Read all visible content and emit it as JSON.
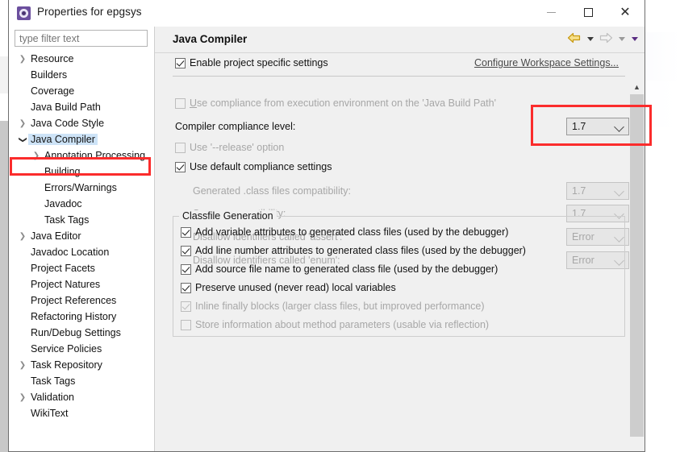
{
  "window": {
    "title": "Properties for epgsys",
    "icon": "properties-gear-icon",
    "minimize_label": "",
    "maximize_label": "",
    "close_label": "✕"
  },
  "sidebar": {
    "filter": {
      "placeholder": "type filter text",
      "value": ""
    },
    "items": [
      {
        "label": "Resource",
        "indent": 0,
        "arrow": "collapsed",
        "selected": false
      },
      {
        "label": "Builders",
        "indent": 0,
        "arrow": "none",
        "selected": false
      },
      {
        "label": "Coverage",
        "indent": 0,
        "arrow": "none",
        "selected": false
      },
      {
        "label": "Java Build Path",
        "indent": 0,
        "arrow": "none",
        "selected": false
      },
      {
        "label": "Java Code Style",
        "indent": 0,
        "arrow": "collapsed",
        "selected": false
      },
      {
        "label": "Java Compiler",
        "indent": 0,
        "arrow": "expanded",
        "selected": true
      },
      {
        "label": "Annotation Processing",
        "indent": 1,
        "arrow": "collapsed",
        "selected": false
      },
      {
        "label": "Building",
        "indent": 1,
        "arrow": "none",
        "selected": false
      },
      {
        "label": "Errors/Warnings",
        "indent": 1,
        "arrow": "none",
        "selected": false
      },
      {
        "label": "Javadoc",
        "indent": 1,
        "arrow": "none",
        "selected": false
      },
      {
        "label": "Task Tags",
        "indent": 1,
        "arrow": "none",
        "selected": false
      },
      {
        "label": "Java Editor",
        "indent": 0,
        "arrow": "collapsed",
        "selected": false
      },
      {
        "label": "Javadoc Location",
        "indent": 0,
        "arrow": "none",
        "selected": false
      },
      {
        "label": "Project Facets",
        "indent": 0,
        "arrow": "none",
        "selected": false
      },
      {
        "label": "Project Natures",
        "indent": 0,
        "arrow": "none",
        "selected": false
      },
      {
        "label": "Project References",
        "indent": 0,
        "arrow": "none",
        "selected": false
      },
      {
        "label": "Refactoring History",
        "indent": 0,
        "arrow": "none",
        "selected": false
      },
      {
        "label": "Run/Debug Settings",
        "indent": 0,
        "arrow": "none",
        "selected": false
      },
      {
        "label": "Service Policies",
        "indent": 0,
        "arrow": "none",
        "selected": false
      },
      {
        "label": "Task Repository",
        "indent": 0,
        "arrow": "collapsed",
        "selected": false
      },
      {
        "label": "Task Tags",
        "indent": 0,
        "arrow": "none",
        "selected": false
      },
      {
        "label": "Validation",
        "indent": 0,
        "arrow": "collapsed",
        "selected": false
      },
      {
        "label": "WikiText",
        "indent": 0,
        "arrow": "none",
        "selected": false
      }
    ]
  },
  "page": {
    "title": "Java Compiler",
    "nav": {
      "back_icon": "back-arrow-icon",
      "back_menu_icon": "chevron-down-icon",
      "forward_icon": "forward-arrow-icon",
      "forward_menu_icon": "chevron-down-icon",
      "view_menu_icon": "chevron-down-icon"
    },
    "enable_project_settings": {
      "label": "Enable project specific settings",
      "checked": true,
      "enabled": true
    },
    "configure_workspace_link": "Configure Workspace Settings...",
    "options": [
      {
        "label": "Use compliance from execution environment on the 'Java Build Path'",
        "type": "checkbox",
        "checked": false,
        "enabled": false
      },
      {
        "label": "Compiler compliance level:",
        "type": "combo",
        "value": "1.7",
        "enabled": true,
        "highlighted": true
      },
      {
        "label": "Use '--release' option",
        "type": "checkbox",
        "checked": false,
        "enabled": false
      },
      {
        "label": "Use default compliance settings",
        "type": "checkbox",
        "checked": true,
        "enabled": true
      },
      {
        "label": "Generated .class files compatibility:",
        "type": "combo",
        "value": "1.7",
        "enabled": false
      },
      {
        "label": "Source compatibility:",
        "type": "combo",
        "value": "1.7",
        "enabled": false
      },
      {
        "label": "Disallow identifiers called 'assert':",
        "type": "combo",
        "value": "Error",
        "enabled": false
      },
      {
        "label": "Disallow identifiers called 'enum':",
        "type": "combo",
        "value": "Error",
        "enabled": false
      }
    ],
    "classfile_group": {
      "legend": "Classfile Generation",
      "checkboxes": [
        {
          "label": "Add variable attributes to generated class files (used by the debugger)",
          "checked": true,
          "enabled": true
        },
        {
          "label": "Add line number attributes to generated class files (used by the debugger)",
          "checked": true,
          "enabled": true
        },
        {
          "label": "Add source file name to generated class file (used by the debugger)",
          "checked": true,
          "enabled": true
        },
        {
          "label": "Preserve unused (never read) local variables",
          "checked": true,
          "enabled": true
        },
        {
          "label": "Inline finally blocks (larger class files, but improved performance)",
          "checked": true,
          "enabled": false
        },
        {
          "label": "Store information about method parameters (usable via reflection)",
          "checked": false,
          "enabled": false
        }
      ]
    },
    "scrollbar": {
      "up_arrow_icon": "chevron-up-icon"
    }
  },
  "colors": {
    "highlight_red": "#fb2c2c",
    "selection_blue": "#cde3f7",
    "dialog_bg": "#f0f0f0",
    "link_grey": "#4a4a4a"
  }
}
